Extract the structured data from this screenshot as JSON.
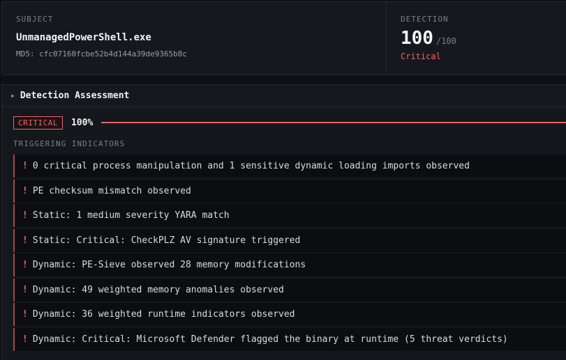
{
  "header": {
    "subject_label": "SUBJECT",
    "subject_name": "UnmanagedPowerShell.exe",
    "md5_label": "MD5:",
    "md5_value": "cfc07160fcbe52b4d144a39de9365b8c",
    "detection_label": "DETECTION",
    "score": "100",
    "score_max": "/100",
    "severity": "Critical"
  },
  "assessment": {
    "title": "Detection Assessment",
    "level_badge": "CRITICAL",
    "level_percent_text": "100%",
    "level_fraction": 1.0,
    "indicators_label": "TRIGGERING INDICATORS",
    "indicators": [
      "0 critical process manipulation and 1 sensitive dynamic loading imports observed",
      "PE checksum mismatch observed",
      "Static: 1 medium severity YARA match",
      "Static: Critical: CheckPLZ AV signature triggered",
      "Dynamic: PE-Sieve observed 28 memory modifications",
      "Dynamic: 49 weighted memory anomalies observed",
      "Dynamic: 36 weighted runtime indicators observed",
      "Dynamic: Critical: Microsoft Defender flagged the binary at runtime (5 threat verdicts)"
    ],
    "indicator_icon": "exclamation-icon"
  },
  "colors": {
    "critical": "#f0646a",
    "background": "#0e1014",
    "panel": "#14171c"
  }
}
